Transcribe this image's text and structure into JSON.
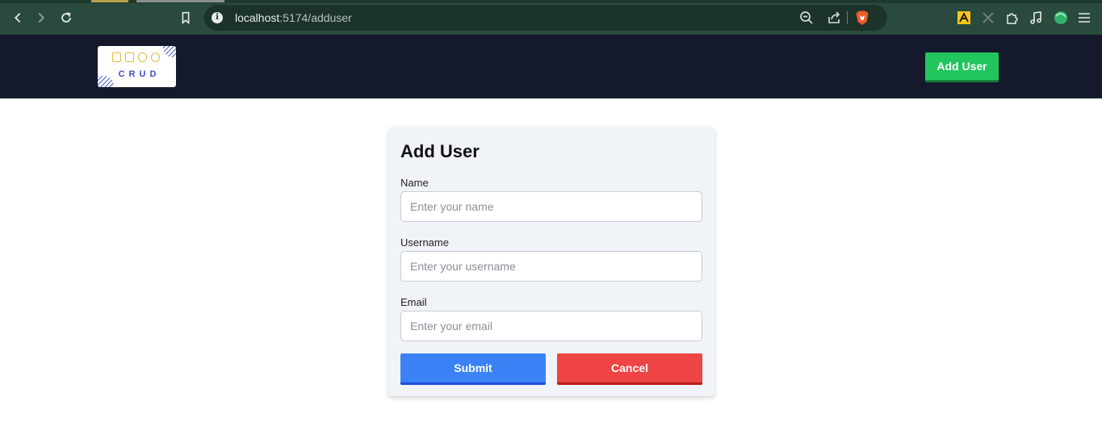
{
  "browser": {
    "url_host": "localhost",
    "url_rest": ":5174/adduser"
  },
  "header": {
    "logo_text": "CRUD",
    "add_user_label": "Add User",
    "add_user_color": "#22c55e",
    "background": "#141a2b"
  },
  "form": {
    "title": "Add User",
    "fields": [
      {
        "label": "Name",
        "placeholder": "Enter your name",
        "value": ""
      },
      {
        "label": "Username",
        "placeholder": "Enter your username",
        "value": ""
      },
      {
        "label": "Email",
        "placeholder": "Enter your email",
        "value": ""
      }
    ],
    "submit_label": "Submit",
    "submit_color": "#3b82f6",
    "cancel_label": "Cancel",
    "cancel_color": "#ef4444"
  }
}
